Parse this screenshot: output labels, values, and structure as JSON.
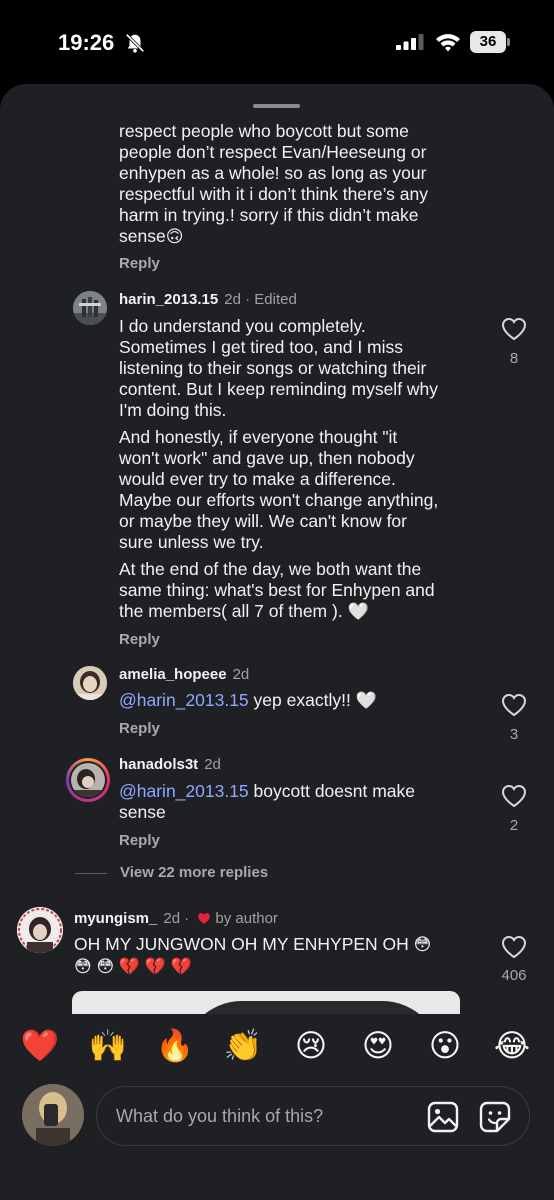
{
  "status_bar": {
    "time": "19:26",
    "battery": "36"
  },
  "comments": {
    "partial": {
      "lines": [
        "respect people who boycott but some",
        "people don’t respect Evan/Heeseung or",
        "enhypen as a whole! so as long as your",
        "respectful with it i don’t think there’s any",
        "harm in trying.! sorry if this didn’t make",
        "sense"
      ],
      "emoji": "🙃",
      "reply": "Reply"
    },
    "harin": {
      "username": "harin_2013.15",
      "meta": "2d · Edited",
      "para1": [
        "I do understand you completely.",
        "Sometimes I get tired too, and I miss",
        "listening to their songs or watching their",
        "content. But I keep reminding myself why",
        "I'm doing this."
      ],
      "para2": [
        "And honestly, if everyone thought \"it",
        "won't work\" and gave up, then nobody",
        "would ever try to make a difference.",
        "Maybe our efforts won't change anything,",
        "or maybe they will. We can't know for",
        "sure unless we try."
      ],
      "para3": [
        "At the end of the day, we both want the",
        "same thing: what's best for Enhypen and",
        "the members( all 7 of them ). "
      ],
      "para3_emoji": "🤍",
      "likes": "8",
      "reply": "Reply"
    },
    "amelia": {
      "username": "amelia_hopeee",
      "meta": "2d",
      "mention": "@harin_2013.15",
      "text": " yep exactly!! ",
      "emoji": "🤍",
      "likes": "3",
      "reply": "Reply"
    },
    "hanadols": {
      "username": "hanadols3t",
      "meta": "2d",
      "mention": "@harin_2013.15",
      "text_line1": " boycott doesnt make",
      "text_line2": "sense",
      "likes": "2",
      "reply": "Reply"
    },
    "view_more": "View 22 more replies",
    "myungism": {
      "username": "myungism_",
      "meta": "2d ·",
      "by_author": "by author",
      "line1": "OH MY JUNGWON OH MY ENHYPEN OH ",
      "line1_emoji": "😳",
      "line2_emoji": "😳 😳 💔 💔 💔",
      "likes": "406"
    }
  },
  "reactions": [
    "❤️",
    "🙌",
    "🔥",
    "👏",
    "😢",
    "😍",
    "😮",
    "😂"
  ],
  "composer": {
    "placeholder": "What do you think of this?"
  },
  "colors": {
    "background": "#1e2023",
    "mention": "#8fa8ff",
    "story_ring": "#e1306c"
  }
}
